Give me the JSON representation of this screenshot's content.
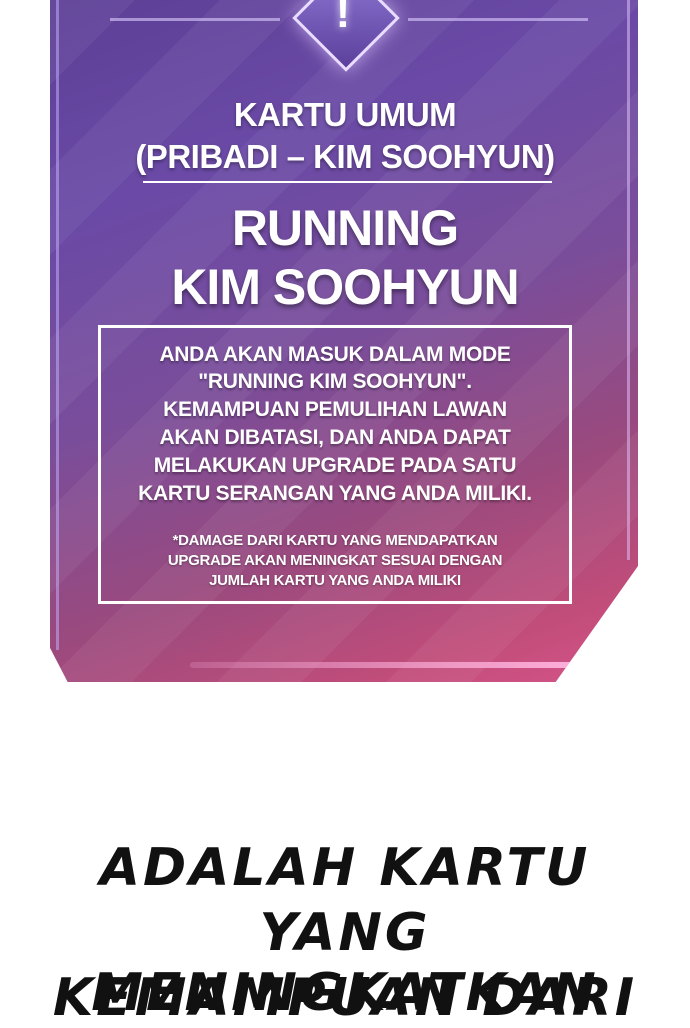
{
  "card": {
    "category_line1": "KARTU UMUM",
    "category_line2": "(PRIBADI – KIM SOOHYUN)",
    "title_line1": "RUNNING",
    "title_line2": "KIM SOOHYUN",
    "description": [
      "ANDA AKAN MASUK DALAM MODE",
      "\"RUNNING KIM SOOHYUN\".",
      "KEMAMPUAN PEMULIHAN LAWAN",
      "AKAN DIBATASI, DAN ANDA DAPAT",
      "MELAKUKAN UPGRADE PADA SATU",
      "KARTU SERANGAN YANG ANDA MILIKI."
    ],
    "note": [
      "*DAMAGE DARI KARTU YANG MENDAPATKAN",
      "UPGRADE AKAN MENINGKAT SESUAI DENGAN",
      "JUMLAH KARTU YANG ANDA MILIKI"
    ],
    "emblem_symbol": "!",
    "emblem_icon": "warning-icon"
  },
  "caption": [
    "ADALAH KARTU",
    "YANG MENINGKATKAN",
    "KEMAMPUAN DARI"
  ],
  "colors": {
    "card_gradient_start": "#5d3f96",
    "card_gradient_end": "#d6548a",
    "text_on_card": "#ffffff",
    "caption_text": "#111111"
  }
}
